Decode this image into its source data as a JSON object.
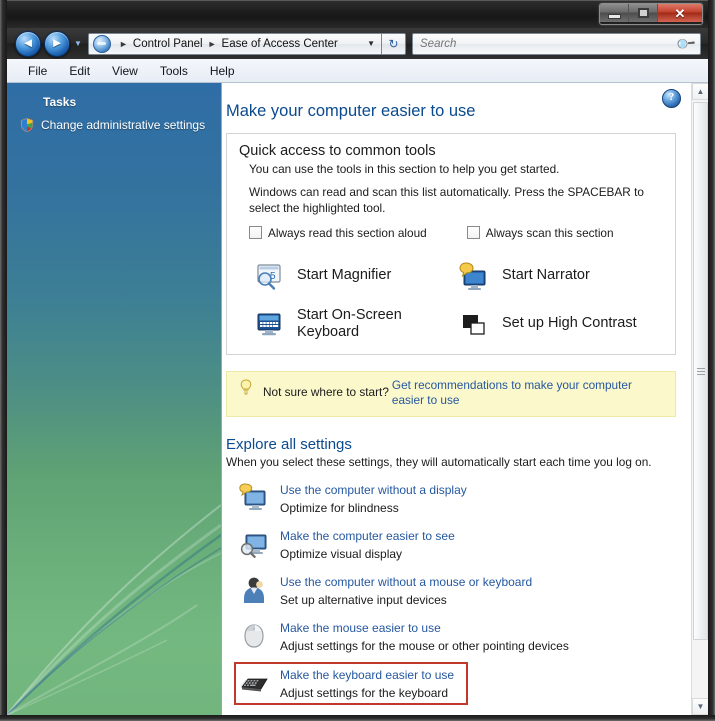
{
  "window": {
    "buttons": {
      "minimize": "minimize-button",
      "maximize": "maximize-button",
      "close": "✕"
    }
  },
  "navigation": {
    "back_glyph": "◄",
    "forward_glyph": "►",
    "history_glyph": "▼",
    "breadcrumbs": [
      "Control Panel",
      "Ease of Access Center"
    ],
    "separator": "►",
    "dropdown_glyph": "▼",
    "refresh_glyph": "↻"
  },
  "search": {
    "placeholder": "Search",
    "value": "",
    "icon": "search-icon"
  },
  "menubar": {
    "items": [
      "File",
      "Edit",
      "View",
      "Tools",
      "Help"
    ]
  },
  "sidebar": {
    "header": "Tasks",
    "links": [
      {
        "label": "Change administrative settings",
        "icon": "shield-icon"
      }
    ]
  },
  "main": {
    "help_glyph": "?",
    "page_title": "Make your computer easier to use",
    "quick_access": {
      "title": "Quick access to common tools",
      "subtitle": "You can use the tools in this section to help you get started.",
      "note": "Windows can read and scan this list automatically.  Press the SPACEBAR to select the highlighted tool.",
      "checkboxes": [
        {
          "label": "Always read this section aloud",
          "checked": false
        },
        {
          "label": "Always scan this section",
          "checked": false
        }
      ],
      "tools": [
        {
          "label": "Start Magnifier",
          "icon": "magnifier-icon"
        },
        {
          "label": "Start Narrator",
          "icon": "narrator-icon"
        },
        {
          "label": "Start On-Screen Keyboard",
          "icon": "on-screen-keyboard-icon"
        },
        {
          "label": "Set up High Contrast",
          "icon": "high-contrast-icon"
        }
      ]
    },
    "tip": {
      "icon": "lightbulb-icon",
      "question": "Not sure where to start?",
      "link": "Get recommendations to make your computer easier to use"
    },
    "explore": {
      "title": "Explore all settings",
      "subtitle": "When you select these settings, they will automatically start each time you log on.",
      "items": [
        {
          "link": "Use the computer without a display",
          "desc": "Optimize for blindness",
          "icon": "display-narrator-icon",
          "highlighted": false
        },
        {
          "link": "Make the computer easier to see",
          "desc": "Optimize visual display",
          "icon": "display-magnify-icon",
          "highlighted": false
        },
        {
          "link": "Use the computer without a mouse or keyboard",
          "desc": "Set up alternative input devices",
          "icon": "person-icon",
          "highlighted": false
        },
        {
          "link": "Make the mouse easier to use",
          "desc": "Adjust settings for the mouse or other pointing devices",
          "icon": "mouse-icon",
          "highlighted": false
        },
        {
          "link": "Make the keyboard easier to use",
          "desc": "Adjust settings for the keyboard",
          "icon": "keyboard-icon",
          "highlighted": true
        }
      ]
    }
  },
  "scrollbar": {
    "up_glyph": "▲",
    "down_glyph": "▼"
  },
  "colors": {
    "title_link": "#0a4a8e",
    "link": "#2558a0",
    "tip_background": "#fbf8cc",
    "highlight_border": "#c0392b",
    "sidebar_top": "#2f6da6",
    "sidebar_bottom": "#72b67e"
  }
}
